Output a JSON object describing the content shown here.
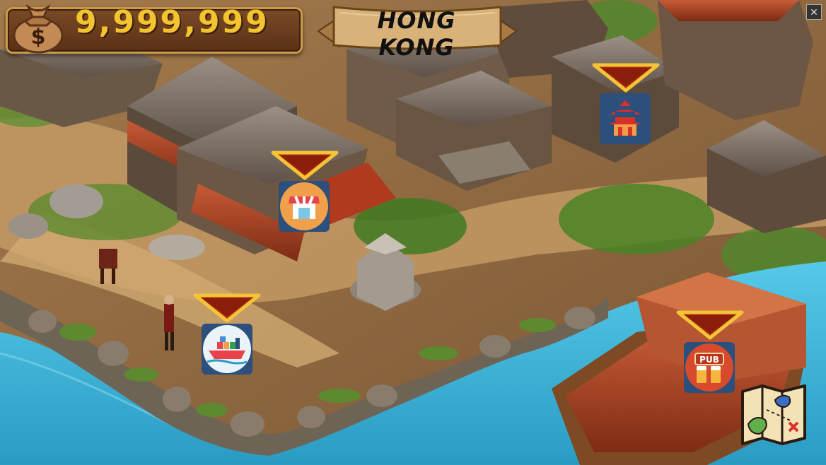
{
  "hud": {
    "money": "9,999,999",
    "city": "HONG KONG",
    "close_label": "✕"
  },
  "icons": {
    "money": "money-bag-dollar-icon",
    "market": "market-stall-icon",
    "palace": "pagoda-palace-icon",
    "harbor": "cargo-ship-icon",
    "pub": "pub-beer-icon",
    "map": "treasure-map-icon"
  },
  "pub_sign": "PUB",
  "colors": {
    "money_text": "#f3c430",
    "panel_wood": "#6a3a1c",
    "banner_parchment": "#d8b278",
    "marker_red": "#b32a12",
    "marker_gold": "#f2c436",
    "water": "#3fb6d9"
  }
}
